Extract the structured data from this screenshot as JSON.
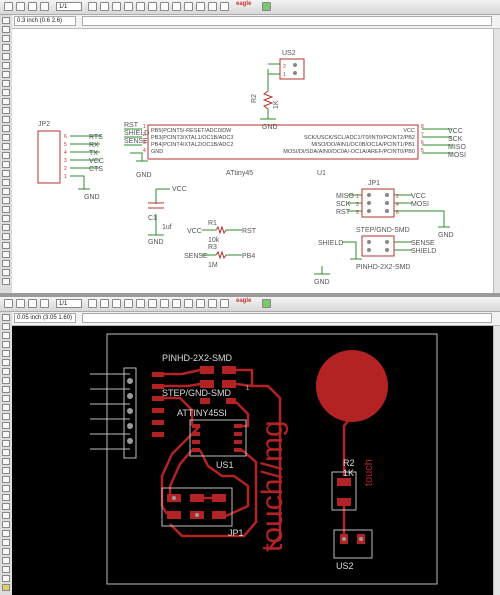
{
  "schematic": {
    "toolbar": {
      "page": "1/1",
      "logo": "eagle"
    },
    "coordinate": "0.3 inch (0.6 2.6)",
    "parts": {
      "us2": {
        "name": "US2",
        "pins": [
          "1",
          "2"
        ]
      },
      "r2": {
        "name": "R2",
        "value": "1K"
      },
      "jp2": {
        "name": "JP2",
        "signals": [
          "RTS",
          "RX",
          "TX",
          "VCC",
          "CTS",
          "GND"
        ],
        "pins": [
          "6",
          "5",
          "4",
          "3",
          "2",
          "1"
        ],
        "gnd": "GND"
      },
      "u1": {
        "name": "U1",
        "chip": "ATtiny45",
        "left_pins": [
          "PB5(PCINT5/-RESET/ADC0/DW",
          "PB3(PCINT3/XTAL1/OC1B/ADC3",
          "PB4(PCINT4/XTAL2/OC1B/ADC2",
          "GND"
        ],
        "left_pin_nums": [
          "1",
          "2",
          "3",
          "4"
        ],
        "left_nets": [
          "RST",
          "SHIELD",
          "SENSE"
        ],
        "gnd": "GND",
        "right_pins": [
          "VCC",
          "SCK/USCK/SCL/ADC1/T0/INT0/PCINT2/PB2",
          "MISO/DO/AIN1/OC0B/OC1A/PCINT1/PB1",
          "MOSI/DI/SDA/AIN0/OC0A/-OC1A/AREF/PCINT0/PB0"
        ],
        "right_pin_nums": [
          "8",
          "7",
          "6",
          "5"
        ],
        "right_nets": [
          "VCC",
          "SCK",
          "MISO",
          "MOSI"
        ]
      },
      "c1": {
        "name": "C1",
        "value": "1uf",
        "vcc": "VCC",
        "gnd": "GND"
      },
      "r1": {
        "name": "R1",
        "value": "10k",
        "left": "VCC",
        "right": "RST"
      },
      "r3": {
        "name": "R3",
        "value": "1M",
        "left": "SENSE",
        "right": "PB4"
      },
      "jp1": {
        "name": "JP1",
        "left_nets": [
          "MISO",
          "SCK",
          "RST"
        ],
        "right_nets": [
          "VCC",
          "MOSI"
        ],
        "pins": [
          "1",
          "2",
          "3",
          "4",
          "5",
          "6"
        ],
        "gnd": "GND",
        "label": "STEP/GND-SMD"
      },
      "pinhd": {
        "left_net": "SHIELD",
        "right_nets": [
          "SENSE",
          "SHIELD"
        ],
        "label": "PINHD-2X2-SMD",
        "gnd": "GND"
      }
    }
  },
  "board": {
    "toolbar": {
      "page": "1/1",
      "logo": "eagle"
    },
    "coordinate": "0.05 inch (3.05 1.60)",
    "labels": {
      "pinhd": "PINHD-2X2-SMD",
      "step": "STEP/GND-SMD",
      "attiny": "ATTINY45SI",
      "u1": "US1",
      "jp1": "JP1",
      "r2": "R2",
      "r2_val": "1K",
      "us2": "US2",
      "touch_big": "touch//mg",
      "touch_small": "touch",
      "pin1": "1"
    },
    "colors": {
      "background": "#000000",
      "copper": "#b42323",
      "outline": "#bdbdbd",
      "pad": "#9b9b9b"
    }
  }
}
